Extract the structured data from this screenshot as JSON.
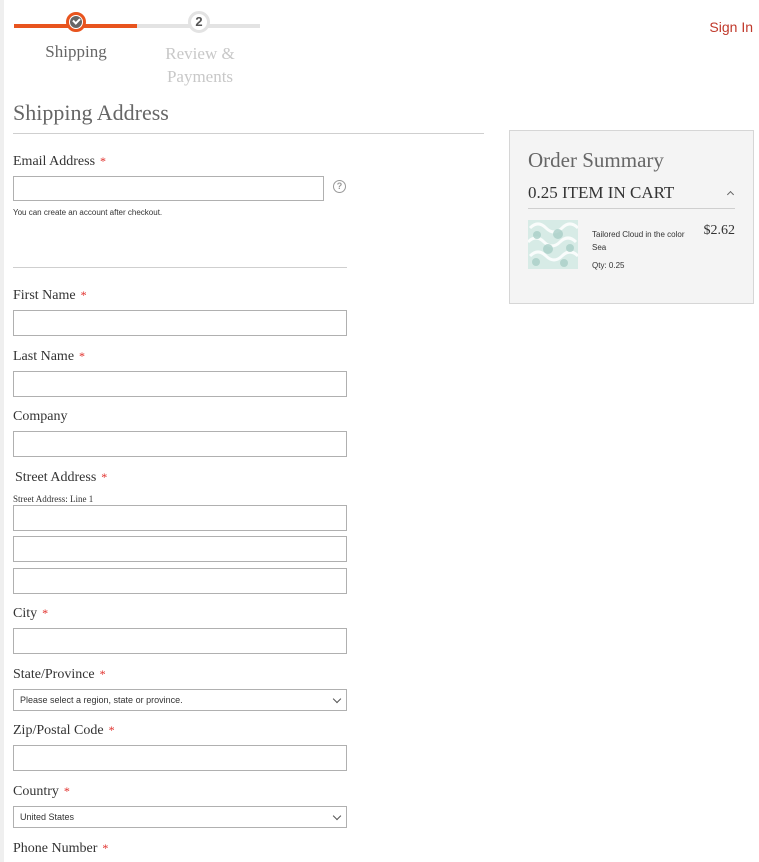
{
  "progress": {
    "steps": [
      {
        "label": "Shipping",
        "state": "complete"
      },
      {
        "number": "2",
        "label": "Review & Payments",
        "state": "pending"
      }
    ],
    "accent_color": "#e8541e"
  },
  "header": {
    "sign_in_label": "Sign In"
  },
  "shipping": {
    "title": "Shipping Address",
    "required_marker": "*",
    "email": {
      "label": "Email Address",
      "value": "",
      "note": "You can create an account after checkout.",
      "help": "?"
    },
    "first_name": {
      "label": "First Name",
      "value": ""
    },
    "last_name": {
      "label": "Last Name",
      "value": ""
    },
    "company": {
      "label": "Company",
      "value": ""
    },
    "street": {
      "label": "Street Address",
      "line1_label": "Street Address: Line 1",
      "lines": [
        "",
        "",
        ""
      ]
    },
    "city": {
      "label": "City",
      "value": ""
    },
    "state": {
      "label": "State/Province",
      "selected": "Please select a region, state or province."
    },
    "zip": {
      "label": "Zip/Postal Code",
      "value": ""
    },
    "country": {
      "label": "Country",
      "selected": "United States"
    },
    "phone": {
      "label": "Phone Number"
    }
  },
  "summary": {
    "title": "Order Summary",
    "items_in_cart": "0.25 ITEM IN CART",
    "item": {
      "name": "Tailored Cloud in the color Sea",
      "price": "$2.62",
      "qty": "Qty: 0.25",
      "swatch_color": "#d7ebe6"
    }
  },
  "icons": [
    "checkmark-icon",
    "help-icon",
    "chevron-down-icon",
    "chevron-up-icon"
  ]
}
